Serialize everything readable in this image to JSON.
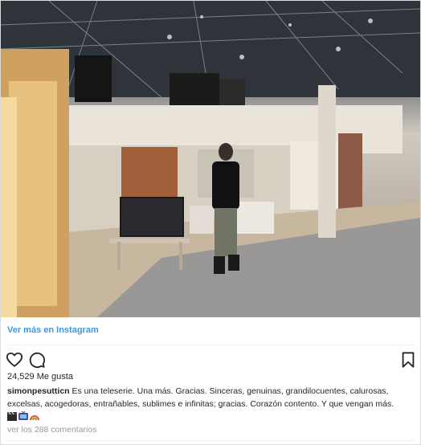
{
  "post": {
    "view_on_instagram": "Ver más en Instagram",
    "likes": "24,529 Me gusta",
    "username": "simonpesutticn",
    "caption": "Es una teleserie. Una más. Gracias. Sinceras, genuinas, grandilocuentes, calurosas, excelsas, acogedoras, entrañables, sublimes e infinitas; gracias. Corazón contento. Y que vengan más.",
    "view_comments": "ver los 288 comentarios"
  },
  "icons": {
    "like": "heart-icon",
    "comment": "comment-icon",
    "save": "bookmark-icon"
  },
  "emojis": [
    "clapper-board-emoji",
    "tv-emoji",
    "rainbow-emoji"
  ],
  "colors": {
    "link": "#3897f0",
    "text": "#262626",
    "muted": "#999999",
    "divider": "#efefef"
  }
}
